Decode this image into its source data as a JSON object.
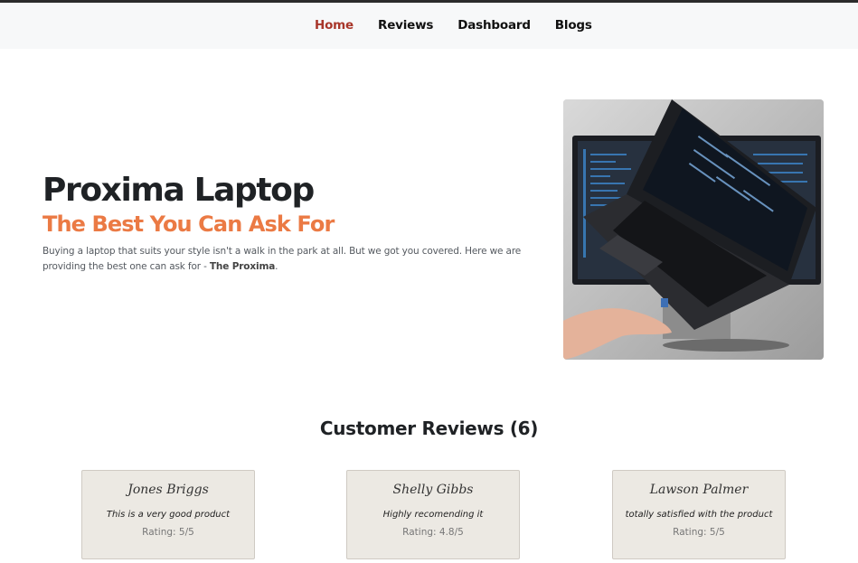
{
  "nav": {
    "items": [
      {
        "label": "Home",
        "active": true
      },
      {
        "label": "Reviews",
        "active": false
      },
      {
        "label": "Dashboard",
        "active": false
      },
      {
        "label": "Blogs",
        "active": false
      }
    ]
  },
  "hero": {
    "title": "Proxima Laptop",
    "subtitle": "The Best You Can Ask For",
    "description_prefix": "Buying a laptop that suits your style isn't a walk in the park at all. But we got you covered. Here we are providing the best one can ask for - ",
    "description_bold": "The Proxima",
    "description_suffix": "."
  },
  "reviews": {
    "heading": "Customer Reviews (6)",
    "items": [
      {
        "name": "Jones Briggs",
        "text": "This is a very good product",
        "rating": "Rating: 5/5"
      },
      {
        "name": "Shelly Gibbs",
        "text": "Highly recomending it",
        "rating": "Rating: 4.8/5"
      },
      {
        "name": "Lawson Palmer",
        "text": "totally satisfied with the product",
        "rating": "Rating: 5/5"
      }
    ]
  },
  "colors": {
    "nav_active": "#a8362a",
    "accent": "#eb7a44",
    "card_bg": "#ece9e3"
  }
}
